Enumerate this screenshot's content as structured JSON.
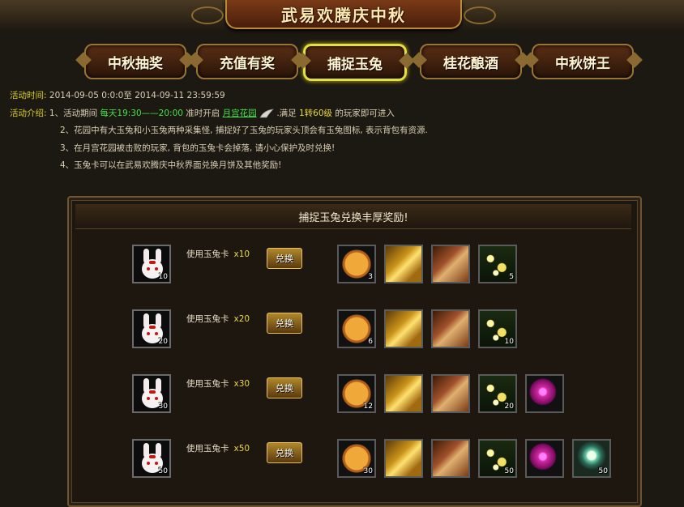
{
  "event_title": "武易欢腾庆中秋",
  "tabs": [
    {
      "label": "中秋抽奖",
      "active": false
    },
    {
      "label": "充值有奖",
      "active": false
    },
    {
      "label": "捕捉玉兔",
      "active": true
    },
    {
      "label": "桂花酿酒",
      "active": false
    },
    {
      "label": "中秋饼王",
      "active": false
    }
  ],
  "info": {
    "time_label": "活动时间:",
    "time_value": "2014-09-05 0:0:0至 2014-09-11 23:59:59",
    "intro_label": "活动介绍:",
    "line1_a": "1、活动期间 ",
    "line1_time": "每天19:30——20:00",
    "line1_b": " 准时开启 ",
    "line1_link": "月宫花园",
    "line1_c": " .满足 ",
    "line1_req": "1转60级",
    "line1_d": " 的玩家即可进入",
    "line2": "2、花园中有大玉兔和小玉兔两种采集怪, 捕捉好了玉兔的玩家头顶会有玉兔图标, 表示背包有资源.",
    "line3": "3、在月宫花园被击败的玩家, 背包的玉兔卡会掉落, 请小心保护及时兑换!",
    "line4": "4、玉兔卡可以在武易欢腾庆中秋界面兑换月饼及其他奖励!"
  },
  "rewards": {
    "header": "捕捉玉兔兑换丰厚奖励!",
    "use_label": "使用玉兔卡",
    "exchange_label": "兑换",
    "rows": [
      {
        "rabbit_count": "10",
        "multiplier": "x10",
        "mooncake": "3",
        "flower": "5"
      },
      {
        "rabbit_count": "20",
        "multiplier": "x20",
        "mooncake": "6",
        "flower": "10"
      },
      {
        "rabbit_count": "30",
        "multiplier": "x30",
        "mooncake": "12",
        "flower": "20"
      },
      {
        "rabbit_count": "50",
        "multiplier": "x50",
        "mooncake": "30",
        "flower": "50",
        "stone": "50"
      }
    ]
  }
}
